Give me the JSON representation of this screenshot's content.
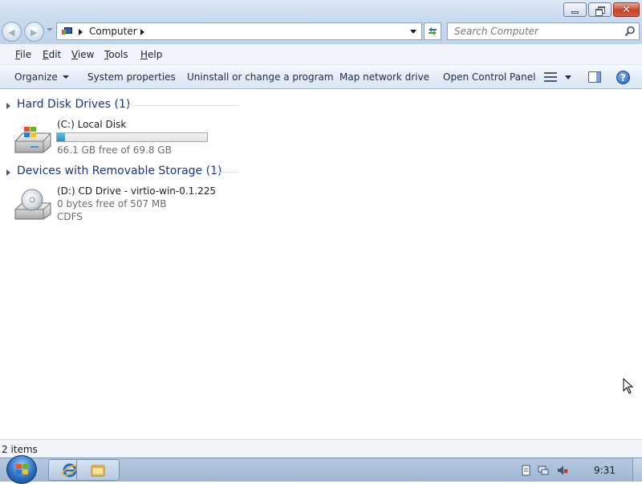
{
  "window": {
    "controls": {
      "minimize_icon": "minimize-icon",
      "maximize_icon": "restore-icon",
      "close_icon": "close-icon"
    }
  },
  "nav": {
    "address_path": "Computer",
    "search_placeholder": "Search Computer"
  },
  "menu": {
    "items": [
      {
        "first": "F",
        "rest": "ile"
      },
      {
        "first": "E",
        "rest": "dit"
      },
      {
        "first": "V",
        "rest": "iew"
      },
      {
        "first": "T",
        "rest": "ools"
      },
      {
        "first": "H",
        "rest": "elp"
      }
    ]
  },
  "commands": {
    "organize": "Organize",
    "system_properties": "System properties",
    "uninstall": "Uninstall or change a program",
    "map_drive": "Map network drive",
    "control_panel": "Open Control Panel",
    "help_glyph": "?"
  },
  "groups": [
    {
      "title": "Hard Disk Drives (1)",
      "drives": [
        {
          "name": "(C:) Local Disk",
          "used_fraction": 0.053,
          "free_text": "66.1 GB free of 69.8 GB"
        }
      ]
    },
    {
      "title": "Devices with Removable Storage (1)",
      "drives": [
        {
          "name": "(D:) CD Drive - virtio-win-0.1.225",
          "free_text": "0 bytes free of 507 MB",
          "filesystem": "CDFS"
        }
      ]
    }
  ],
  "status": {
    "items_text": "2 items"
  },
  "taskbar": {
    "clock": "9:31"
  },
  "colors": {
    "group_title": "#1e3287",
    "bar_fill": "#2a90c2",
    "accent": "#1f5fb8"
  }
}
